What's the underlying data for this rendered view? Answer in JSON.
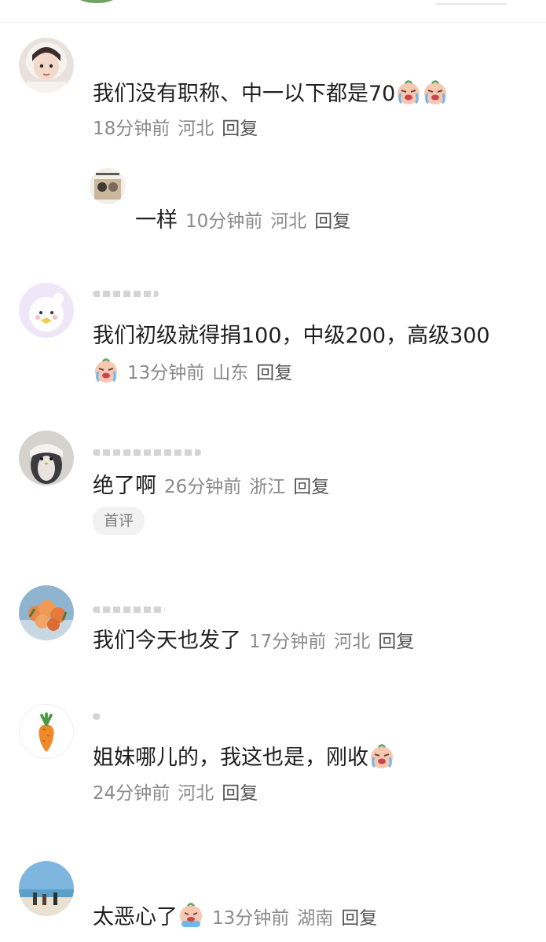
{
  "comments": [
    {
      "text": "我们没有职称、中一以下都是70",
      "time": "18分钟前",
      "location": "河北",
      "reply": "回复",
      "emojis": [
        "crying-face",
        "crying-face"
      ],
      "sub_reply": {
        "text": "一样",
        "time": "10分钟前",
        "location": "河北",
        "reply": "回复"
      }
    },
    {
      "text": "我们初级就得捐100，中级200，高级300",
      "time": "13分钟前",
      "location": "山东",
      "reply": "回复",
      "emojis": [
        "crying-face"
      ]
    },
    {
      "text": "绝了啊",
      "time": "26分钟前",
      "location": "浙江",
      "reply": "回复",
      "badge": "首评"
    },
    {
      "text": "我们今天也发了",
      "time": "17分钟前",
      "location": "河北",
      "reply": "回复"
    },
    {
      "text": "姐妹哪儿的，我这也是，刚收",
      "time": "24分钟前",
      "location": "河北",
      "reply": "回复",
      "emojis": [
        "crying-face"
      ]
    },
    {
      "text": "太恶心了",
      "time": "13分钟前",
      "location": "湖南",
      "reply": "回复",
      "emojis": [
        "sobbing-face"
      ]
    }
  ]
}
